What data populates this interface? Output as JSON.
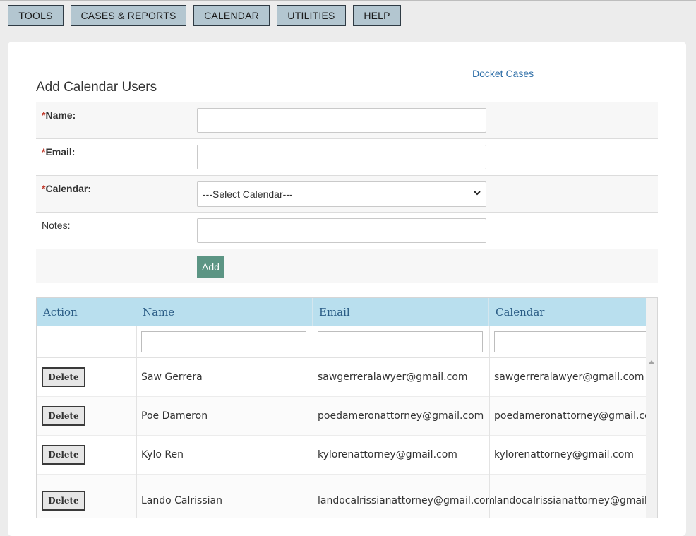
{
  "nav": {
    "tools": "TOOLS",
    "cases_reports": "CASES & REPORTS",
    "calendar": "CALENDAR",
    "utilities": "UTILITIES",
    "help": "HELP"
  },
  "header": {
    "docket_link": "Docket Cases",
    "title": "Add Calendar Users"
  },
  "form": {
    "required_mark": "*",
    "name_label": "Name:",
    "email_label": "Email:",
    "calendar_label": "Calendar:",
    "calendar_selected": "---Select Calendar---",
    "notes_label": "Notes:",
    "add_label": "Add",
    "name_value": "",
    "email_value": "",
    "notes_value": ""
  },
  "grid": {
    "columns": [
      "Action",
      "Name",
      "Email",
      "Calendar"
    ],
    "delete_label": "Delete",
    "rows": [
      {
        "name": "Saw Gerrera",
        "email": "sawgerreralawyer@gmail.com",
        "calendar": "sawgerreralawyer@gmail.com"
      },
      {
        "name": "Poe Dameron",
        "email": "poedameronattorney@gmail.com",
        "calendar": "poedameronattorney@gmail.com"
      },
      {
        "name": "Kylo Ren",
        "email": "kylorenattorney@gmail.com",
        "calendar": "kylorenattorney@gmail.com"
      },
      {
        "name": "Lando Calrissian",
        "email": "landocalrissianattorney@gmail.com",
        "calendar": "landocalrissianattorney@gmail.com"
      }
    ]
  },
  "colors": {
    "nav_button": "#b3c6d0",
    "grid_header": "#b9dfee",
    "add_button": "#5c9584",
    "link": "#2f6fa8"
  },
  "icons": {
    "select_arrow": "chevron-down-icon",
    "scroll_up": "scroll-up-arrow-icon"
  }
}
